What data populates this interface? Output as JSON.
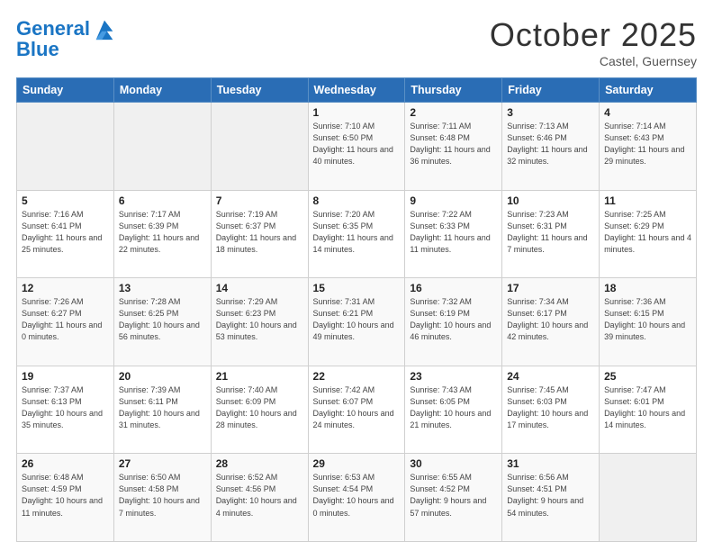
{
  "header": {
    "logo_line1": "General",
    "logo_line2": "Blue",
    "month": "October 2025",
    "location": "Castel, Guernsey"
  },
  "days_of_week": [
    "Sunday",
    "Monday",
    "Tuesday",
    "Wednesday",
    "Thursday",
    "Friday",
    "Saturday"
  ],
  "weeks": [
    [
      {
        "day": "",
        "info": ""
      },
      {
        "day": "",
        "info": ""
      },
      {
        "day": "",
        "info": ""
      },
      {
        "day": "1",
        "info": "Sunrise: 7:10 AM\nSunset: 6:50 PM\nDaylight: 11 hours\nand 40 minutes."
      },
      {
        "day": "2",
        "info": "Sunrise: 7:11 AM\nSunset: 6:48 PM\nDaylight: 11 hours\nand 36 minutes."
      },
      {
        "day": "3",
        "info": "Sunrise: 7:13 AM\nSunset: 6:46 PM\nDaylight: 11 hours\nand 32 minutes."
      },
      {
        "day": "4",
        "info": "Sunrise: 7:14 AM\nSunset: 6:43 PM\nDaylight: 11 hours\nand 29 minutes."
      }
    ],
    [
      {
        "day": "5",
        "info": "Sunrise: 7:16 AM\nSunset: 6:41 PM\nDaylight: 11 hours\nand 25 minutes."
      },
      {
        "day": "6",
        "info": "Sunrise: 7:17 AM\nSunset: 6:39 PM\nDaylight: 11 hours\nand 22 minutes."
      },
      {
        "day": "7",
        "info": "Sunrise: 7:19 AM\nSunset: 6:37 PM\nDaylight: 11 hours\nand 18 minutes."
      },
      {
        "day": "8",
        "info": "Sunrise: 7:20 AM\nSunset: 6:35 PM\nDaylight: 11 hours\nand 14 minutes."
      },
      {
        "day": "9",
        "info": "Sunrise: 7:22 AM\nSunset: 6:33 PM\nDaylight: 11 hours\nand 11 minutes."
      },
      {
        "day": "10",
        "info": "Sunrise: 7:23 AM\nSunset: 6:31 PM\nDaylight: 11 hours\nand 7 minutes."
      },
      {
        "day": "11",
        "info": "Sunrise: 7:25 AM\nSunset: 6:29 PM\nDaylight: 11 hours\nand 4 minutes."
      }
    ],
    [
      {
        "day": "12",
        "info": "Sunrise: 7:26 AM\nSunset: 6:27 PM\nDaylight: 11 hours\nand 0 minutes."
      },
      {
        "day": "13",
        "info": "Sunrise: 7:28 AM\nSunset: 6:25 PM\nDaylight: 10 hours\nand 56 minutes."
      },
      {
        "day": "14",
        "info": "Sunrise: 7:29 AM\nSunset: 6:23 PM\nDaylight: 10 hours\nand 53 minutes."
      },
      {
        "day": "15",
        "info": "Sunrise: 7:31 AM\nSunset: 6:21 PM\nDaylight: 10 hours\nand 49 minutes."
      },
      {
        "day": "16",
        "info": "Sunrise: 7:32 AM\nSunset: 6:19 PM\nDaylight: 10 hours\nand 46 minutes."
      },
      {
        "day": "17",
        "info": "Sunrise: 7:34 AM\nSunset: 6:17 PM\nDaylight: 10 hours\nand 42 minutes."
      },
      {
        "day": "18",
        "info": "Sunrise: 7:36 AM\nSunset: 6:15 PM\nDaylight: 10 hours\nand 39 minutes."
      }
    ],
    [
      {
        "day": "19",
        "info": "Sunrise: 7:37 AM\nSunset: 6:13 PM\nDaylight: 10 hours\nand 35 minutes."
      },
      {
        "day": "20",
        "info": "Sunrise: 7:39 AM\nSunset: 6:11 PM\nDaylight: 10 hours\nand 31 minutes."
      },
      {
        "day": "21",
        "info": "Sunrise: 7:40 AM\nSunset: 6:09 PM\nDaylight: 10 hours\nand 28 minutes."
      },
      {
        "day": "22",
        "info": "Sunrise: 7:42 AM\nSunset: 6:07 PM\nDaylight: 10 hours\nand 24 minutes."
      },
      {
        "day": "23",
        "info": "Sunrise: 7:43 AM\nSunset: 6:05 PM\nDaylight: 10 hours\nand 21 minutes."
      },
      {
        "day": "24",
        "info": "Sunrise: 7:45 AM\nSunset: 6:03 PM\nDaylight: 10 hours\nand 17 minutes."
      },
      {
        "day": "25",
        "info": "Sunrise: 7:47 AM\nSunset: 6:01 PM\nDaylight: 10 hours\nand 14 minutes."
      }
    ],
    [
      {
        "day": "26",
        "info": "Sunrise: 6:48 AM\nSunset: 4:59 PM\nDaylight: 10 hours\nand 11 minutes."
      },
      {
        "day": "27",
        "info": "Sunrise: 6:50 AM\nSunset: 4:58 PM\nDaylight: 10 hours\nand 7 minutes."
      },
      {
        "day": "28",
        "info": "Sunrise: 6:52 AM\nSunset: 4:56 PM\nDaylight: 10 hours\nand 4 minutes."
      },
      {
        "day": "29",
        "info": "Sunrise: 6:53 AM\nSunset: 4:54 PM\nDaylight: 10 hours\nand 0 minutes."
      },
      {
        "day": "30",
        "info": "Sunrise: 6:55 AM\nSunset: 4:52 PM\nDaylight: 9 hours\nand 57 minutes."
      },
      {
        "day": "31",
        "info": "Sunrise: 6:56 AM\nSunset: 4:51 PM\nDaylight: 9 hours\nand 54 minutes."
      },
      {
        "day": "",
        "info": ""
      }
    ]
  ]
}
